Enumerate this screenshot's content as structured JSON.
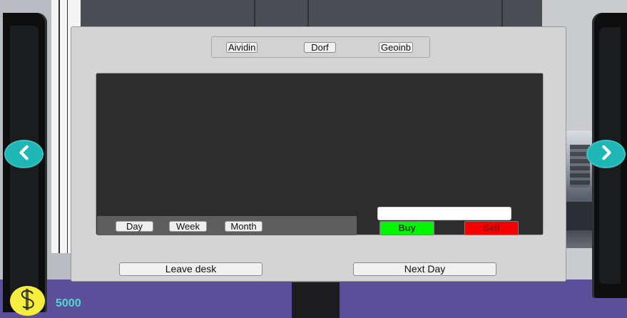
{
  "assets": {
    "items": [
      "Aividin",
      "Dorf",
      "Geoinb"
    ]
  },
  "chart": {
    "ranges": [
      "Day",
      "Week",
      "Month"
    ]
  },
  "trade": {
    "quantity_value": "",
    "buy_label": "Buy",
    "sell_label": "Sell"
  },
  "actions": {
    "leave_label": "Leave desk",
    "next_label": "Next Day"
  },
  "hud": {
    "money": "5000",
    "currency_icon": "dollar-icon"
  },
  "navigation": {
    "prev_icon": "chevron-left-icon",
    "next_icon": "chevron-right-icon"
  },
  "colors": {
    "buy": "#00f500",
    "sell": "#f50000",
    "nav_arrow": "#1fb6b6",
    "money_text": "#4fd9cf",
    "coin": "#f5ee3f"
  }
}
